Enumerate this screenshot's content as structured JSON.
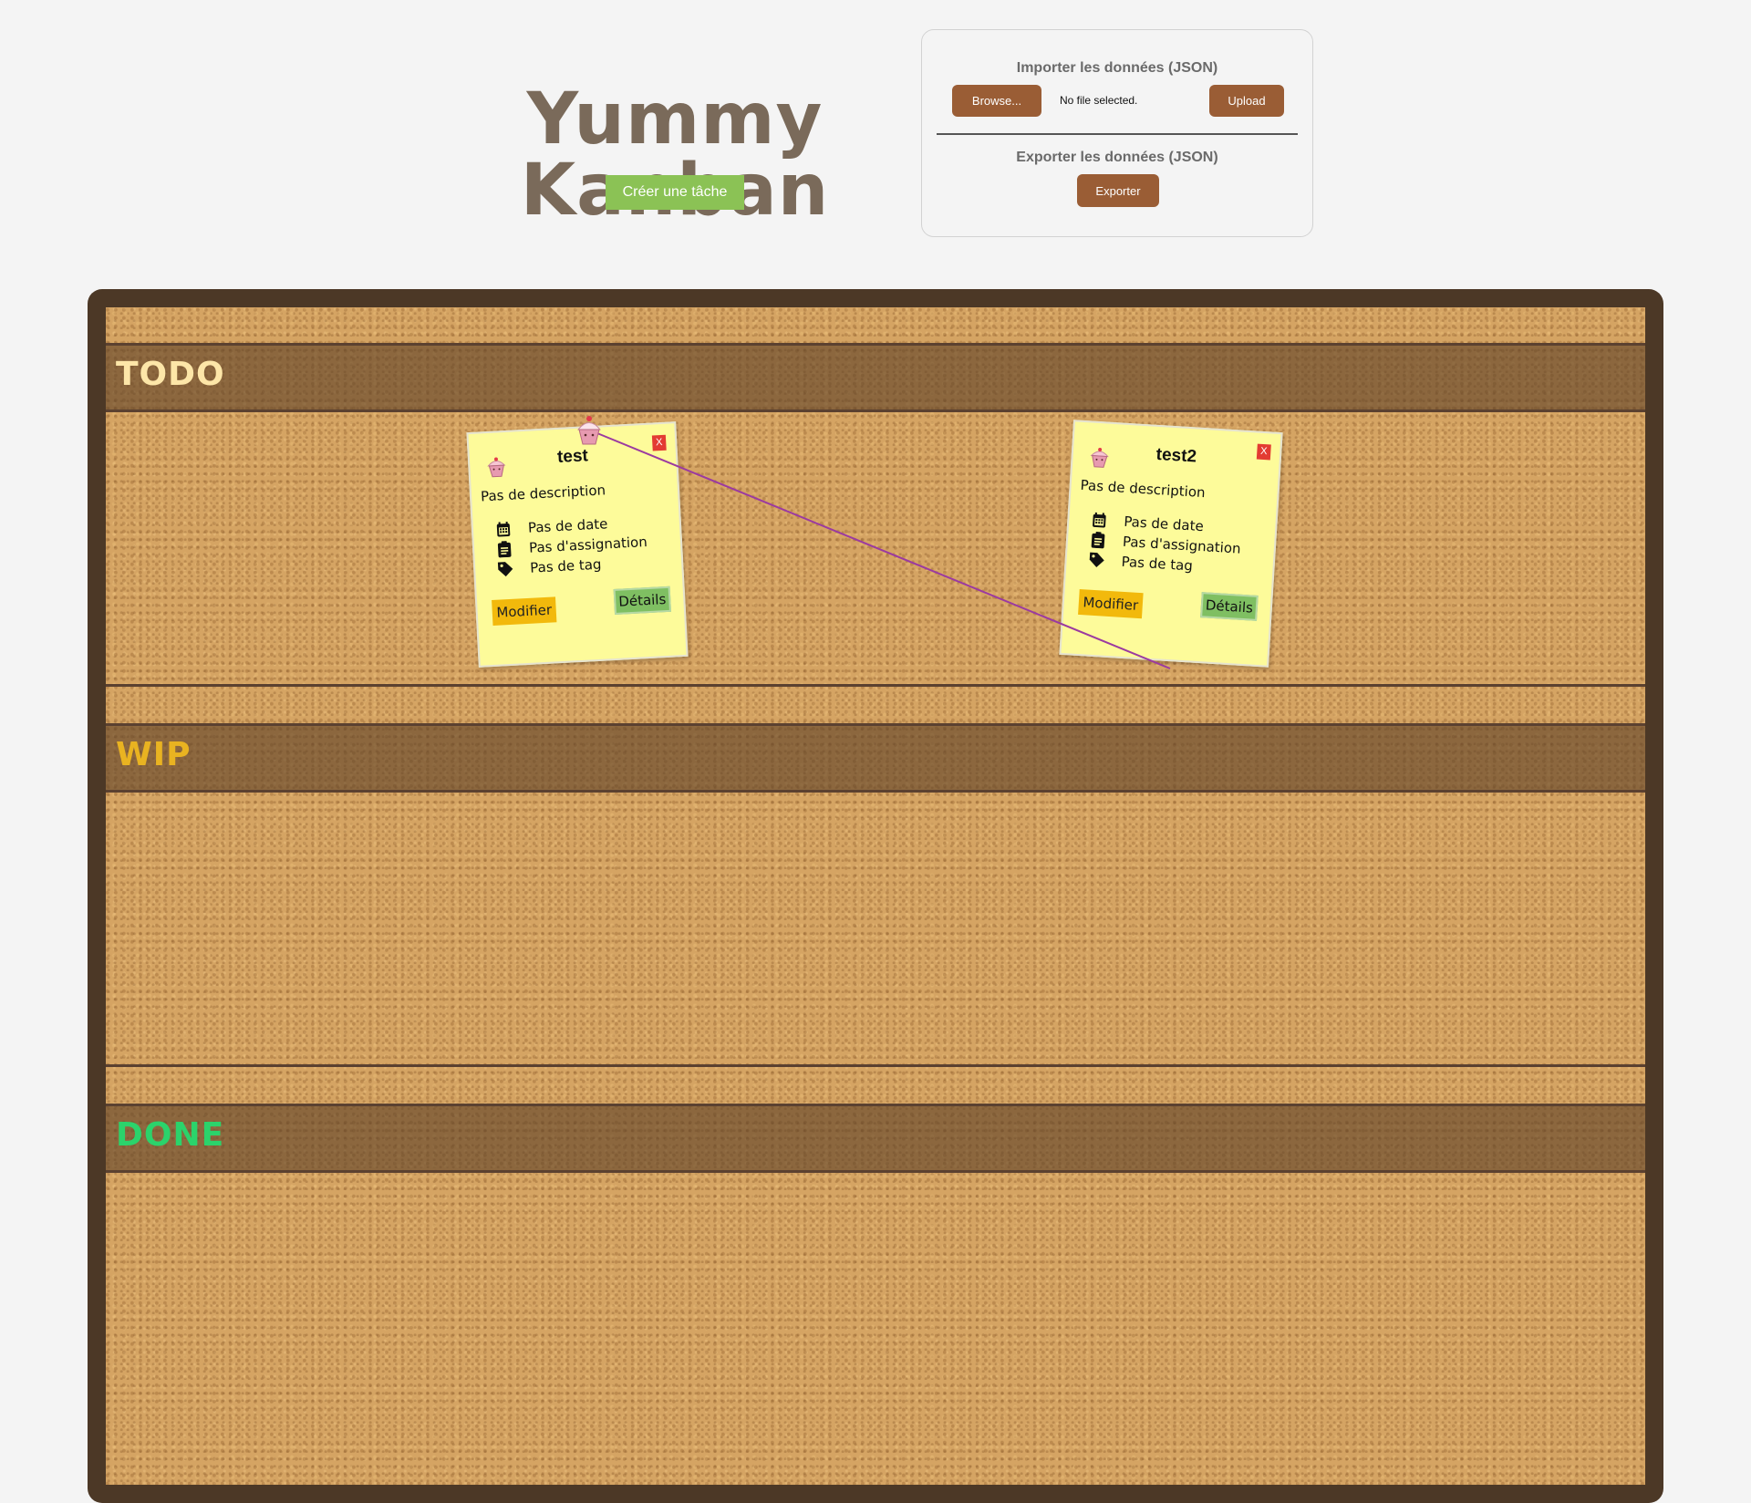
{
  "header": {
    "app_title": "Yummy Kanban",
    "create_task_label": "Créer une tâche"
  },
  "data_panel": {
    "import_heading": "Importer les données (JSON)",
    "browse_label": "Browse...",
    "file_status": "No file selected.",
    "upload_label": "Upload",
    "export_heading": "Exporter les données (JSON)",
    "export_label": "Exporter"
  },
  "lanes": [
    {
      "title": "TODO",
      "color": "#fde6a8"
    },
    {
      "title": "WIP",
      "color": "#e9b321"
    },
    {
      "title": "DONE",
      "color": "#2bd36b"
    }
  ],
  "tasks": [
    {
      "title": "test",
      "delete_label": "X",
      "description": "Pas de description",
      "date": "Pas de date",
      "assignment": "Pas d'assignation",
      "tag": "Pas de tag",
      "edit_label": "Modifier",
      "details_label": "Détails",
      "icon": "cupcake-icon"
    },
    {
      "title": "test2",
      "delete_label": "X",
      "description": "Pas de description",
      "date": "Pas de date",
      "assignment": "Pas d'assignation",
      "tag": "Pas de tag",
      "edit_label": "Modifier",
      "details_label": "Détails",
      "icon": "cupcake-icon"
    }
  ],
  "colors": {
    "board_frame": "#4c3826",
    "cork": "#d5a463",
    "note": "#fdfb9a",
    "create_button": "#8bc255",
    "brown_button": "#9a5d35",
    "edit_button": "#f2b90c",
    "details_button": "#7fbf62",
    "delete_button": "#e33b32",
    "connector_line": "#9b3aa0"
  }
}
